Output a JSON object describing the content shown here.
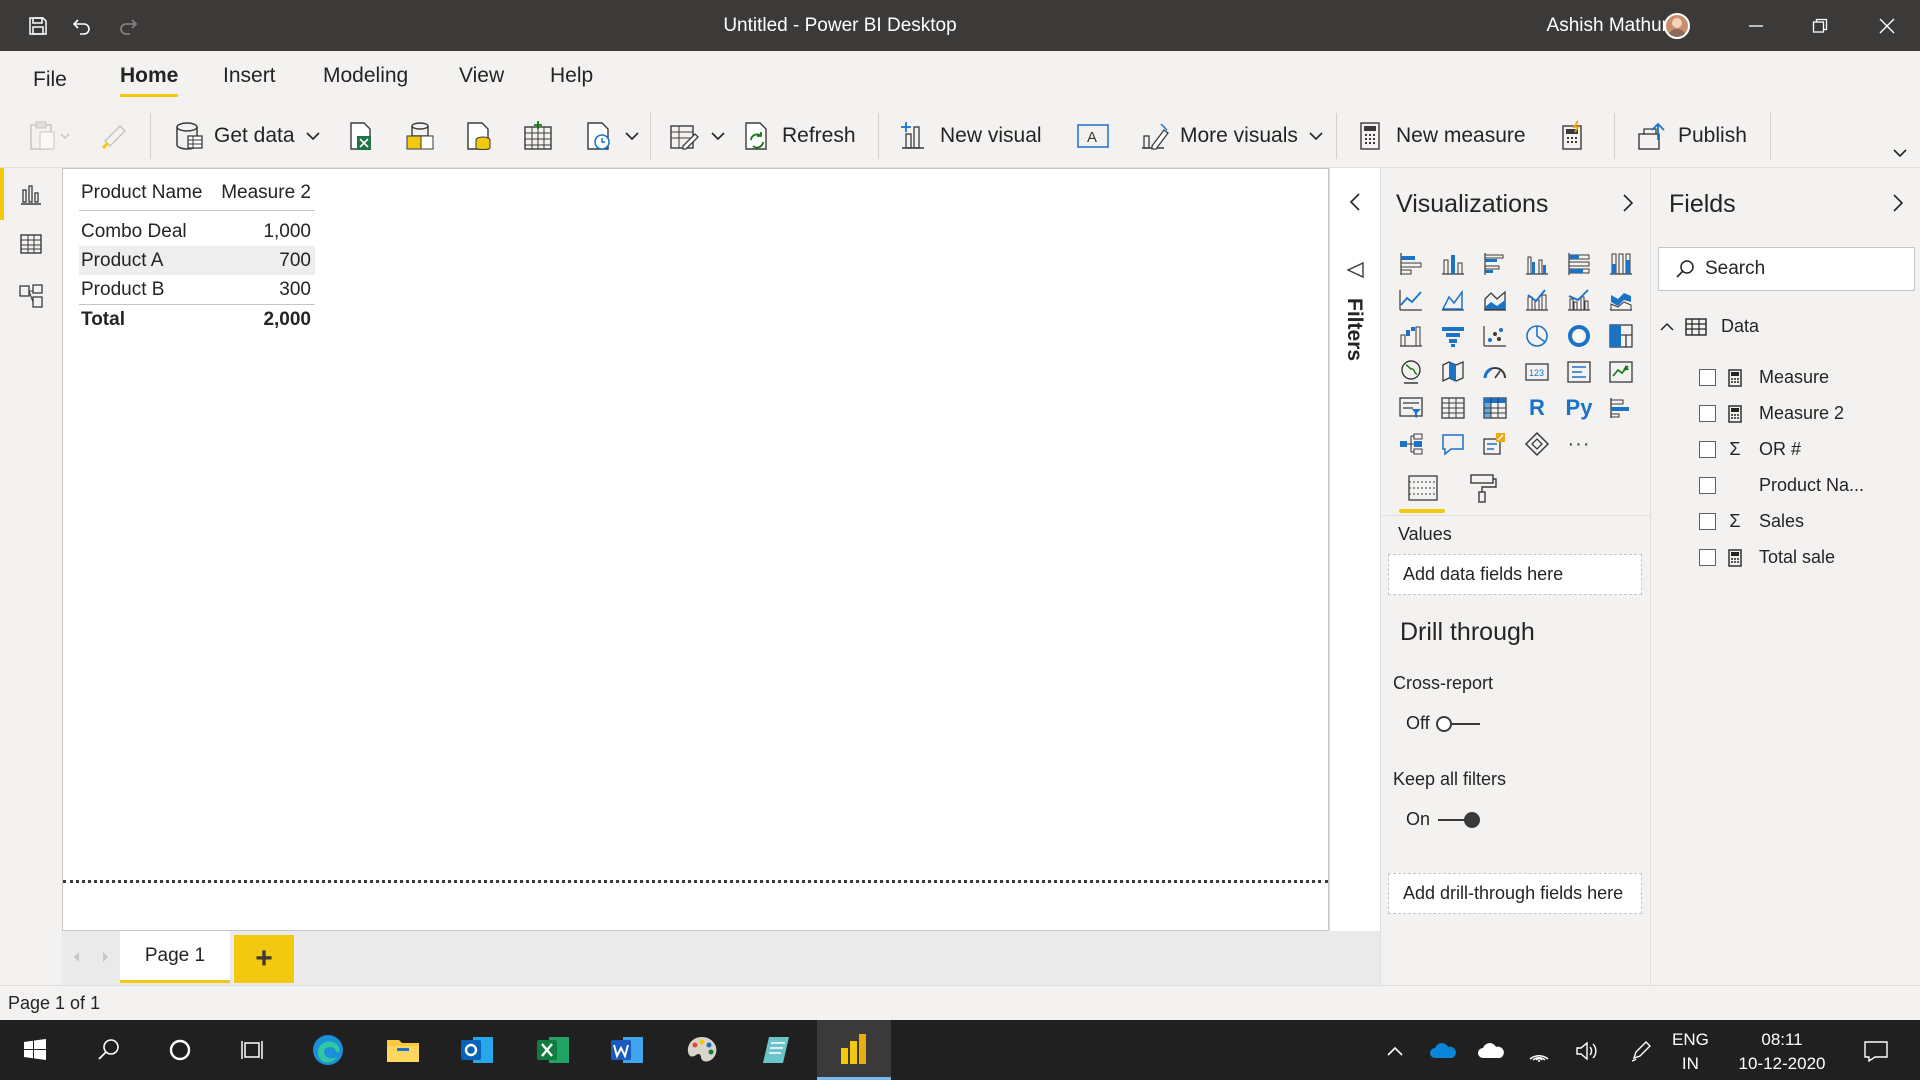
{
  "window": {
    "title": "Untitled - Power BI Desktop",
    "user_name": "Ashish Mathur"
  },
  "menu_tabs": [
    "File",
    "Home",
    "Insert",
    "Modeling",
    "View",
    "Help"
  ],
  "active_tab": "Home",
  "ribbon": {
    "get_data": "Get data",
    "refresh": "Refresh",
    "new_visual": "New visual",
    "more_visuals": "More visuals",
    "new_measure": "New measure",
    "publish": "Publish"
  },
  "table_visual": {
    "headers": [
      "Product Name",
      "Measure 2"
    ],
    "rows": [
      {
        "name": "Combo Deal",
        "value": "1,000"
      },
      {
        "name": "Product A",
        "value": "700"
      },
      {
        "name": "Product B",
        "value": "300"
      }
    ],
    "total": {
      "label": "Total",
      "value": "2,000"
    }
  },
  "filters_label": "Filters",
  "page_tabs": {
    "page1": "Page 1",
    "add": "+"
  },
  "visualizations": {
    "title": "Visualizations",
    "values_label": "Values",
    "values_placeholder": "Add data fields here",
    "drill_title": "Drill through",
    "cross_report_label": "Cross-report",
    "cross_report_state": "Off",
    "keep_filters_label": "Keep all filters",
    "keep_filters_state": "On",
    "drill_placeholder": "Add drill-through fields here",
    "r_label": "R",
    "py_label": "Py",
    "more_label": "···"
  },
  "fields": {
    "title": "Fields",
    "search_placeholder": "Search",
    "table_name": "Data",
    "items": [
      {
        "name": "Measure",
        "icon": "calculator-icon"
      },
      {
        "name": "Measure 2",
        "icon": "calculator-icon"
      },
      {
        "name": "OR #",
        "icon": "sigma-icon"
      },
      {
        "name": "Product Na...",
        "icon": "none"
      },
      {
        "name": "Sales",
        "icon": "sigma-icon"
      },
      {
        "name": "Total sale",
        "icon": "calculator-icon"
      }
    ]
  },
  "status": {
    "page_info": "Page 1 of 1"
  },
  "taskbar": {
    "lang_line1": "ENG",
    "lang_line2": "IN",
    "time": "08:11",
    "date": "10-12-2020"
  },
  "colors": {
    "accent_yellow": "#f2c811",
    "titlebar": "#3b3a39",
    "pane_bg": "#f3f2f1",
    "taskbar": "#202020",
    "icon_blue": "#1a73c7"
  }
}
